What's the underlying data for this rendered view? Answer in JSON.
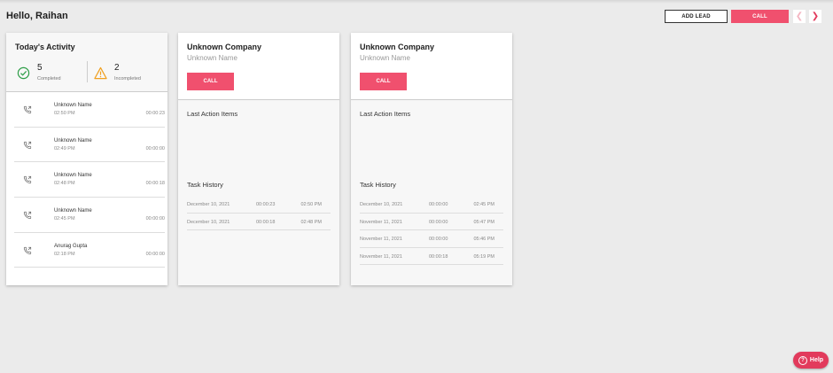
{
  "header": {
    "greeting": "Hello, Raihan",
    "add_lead_label": "ADD LEAD",
    "call_label": "CALL",
    "prev_icon": "chevron-left-icon",
    "next_icon": "chevron-right-icon"
  },
  "activity": {
    "title": "Today's Activity",
    "completed": {
      "count": "5",
      "label": "Completed"
    },
    "incompleted": {
      "count": "2",
      "label": "Incompleted"
    },
    "items": [
      {
        "name": "Unknown Name",
        "time": "02:50 PM",
        "duration": "00:00:23"
      },
      {
        "name": "Unknown Name",
        "time": "02:49 PM",
        "duration": "00:00:00"
      },
      {
        "name": "Unknown Name",
        "time": "02:48 PM",
        "duration": "00:00:18"
      },
      {
        "name": "Unknown Name",
        "time": "02:45 PM",
        "duration": "00:00:00"
      },
      {
        "name": "Anurag Gupta",
        "time": "02:18 PM",
        "duration": "00:00:00"
      }
    ]
  },
  "leads": [
    {
      "company": "Unknown Company",
      "contact": "Unknown Name",
      "call_label": "CALL",
      "last_actions_title": "Last Action Items",
      "task_history_title": "Task History",
      "history": [
        {
          "date": "December 10, 2021",
          "duration": "00:00:23",
          "time": "02:50 PM"
        },
        {
          "date": "December 10, 2021",
          "duration": "00:00:18",
          "time": "02:48 PM"
        }
      ]
    },
    {
      "company": "Unknown Company",
      "contact": "Unknown Name",
      "call_label": "CALL",
      "last_actions_title": "Last Action Items",
      "task_history_title": "Task History",
      "history": [
        {
          "date": "December 10, 2021",
          "duration": "00:00:00",
          "time": "02:45 PM"
        },
        {
          "date": "November 11, 2021",
          "duration": "00:00:00",
          "time": "05:47 PM"
        },
        {
          "date": "November 11, 2021",
          "duration": "00:00:00",
          "time": "05:46 PM"
        },
        {
          "date": "November 11, 2021",
          "duration": "00:00:18",
          "time": "05:19 PM"
        }
      ]
    }
  ],
  "help": {
    "label": "Help",
    "icon": "help-circle-icon"
  },
  "colors": {
    "accent": "#f0506e",
    "success": "#2e9e48",
    "warning": "#f0a020"
  }
}
